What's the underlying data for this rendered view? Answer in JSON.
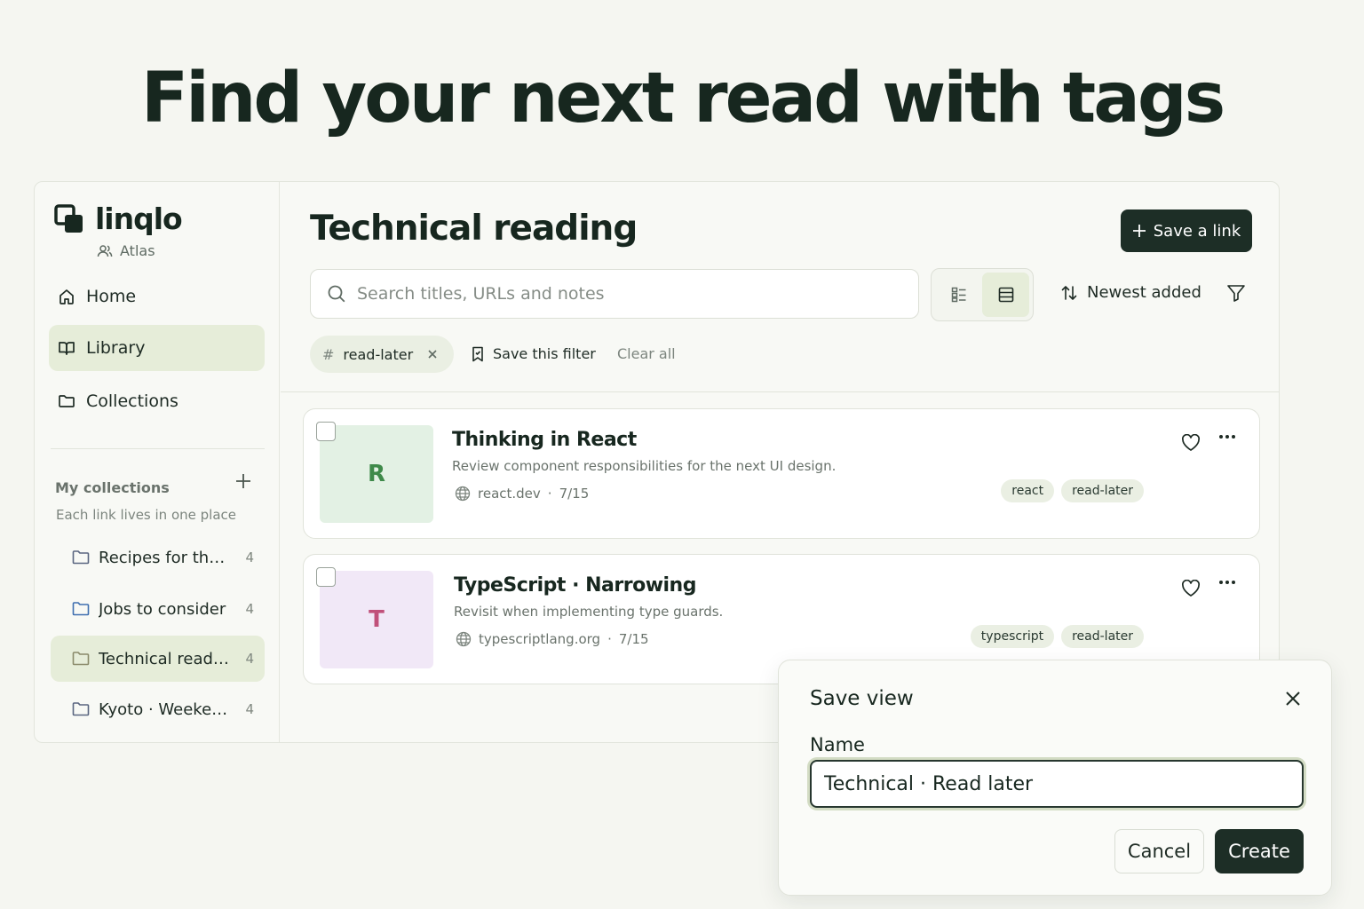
{
  "hero": {
    "headline": "Find your next read with tags"
  },
  "brand": {
    "name": "linqlo",
    "workspace": "Atlas",
    "logo_icon": "logo-icon"
  },
  "sidebar": {
    "nav": [
      {
        "label": "Home",
        "icon": "home-icon",
        "active": false
      },
      {
        "label": "Library",
        "icon": "book-icon",
        "active": true
      },
      {
        "label": "Collections",
        "icon": "folder-icon",
        "active": false
      }
    ],
    "my_collections": {
      "title": "My collections",
      "subtitle": "Each link lives in one place",
      "add_icon": "plus-icon",
      "items": [
        {
          "label": "Recipes for th…",
          "count": "4",
          "active": false
        },
        {
          "label": "Jobs to consider",
          "count": "4",
          "active": false
        },
        {
          "label": "Technical read…",
          "count": "4",
          "active": true
        },
        {
          "label": "Kyoto · Weeke…",
          "count": "4",
          "active": false
        }
      ]
    }
  },
  "main": {
    "title": "Technical reading",
    "save_link_label": "Save a link",
    "search": {
      "placeholder": "Search titles, URLs and notes",
      "value": ""
    },
    "view_toggle": {
      "options": [
        "grid-view-icon",
        "list-view-icon"
      ],
      "selected": "list-view-icon"
    },
    "sort_label": "Newest added",
    "active_filter": {
      "hash": "#",
      "tag": "read-later"
    },
    "save_filter_label": "Save this filter",
    "clear_all_label": "Clear all",
    "links": [
      {
        "initial": "R",
        "title": "Thinking in React",
        "description": "Review component responsibilities for the next UI design.",
        "domain": "react.dev",
        "date": "7/15",
        "tags": [
          "react",
          "read-later"
        ],
        "thumb_bg": "#e3f1e4",
        "thumb_fg": "#3f8a4a"
      },
      {
        "initial": "T",
        "title": "TypeScript · Narrowing",
        "description": "Revisit when implementing type guards.",
        "domain": "typescriptlang.org",
        "date": "7/15",
        "tags": [
          "typescript",
          "read-later"
        ],
        "thumb_bg": "#f1e8f7",
        "thumb_fg": "#c0507a"
      }
    ]
  },
  "dialog": {
    "title": "Save view",
    "name_label": "Name",
    "name_value": "Technical · Read later",
    "cancel_label": "Cancel",
    "create_label": "Create"
  },
  "colors": {
    "accent": "#1d2e26",
    "active_bg": "#e6edd9",
    "background": "#f5f6f1"
  }
}
